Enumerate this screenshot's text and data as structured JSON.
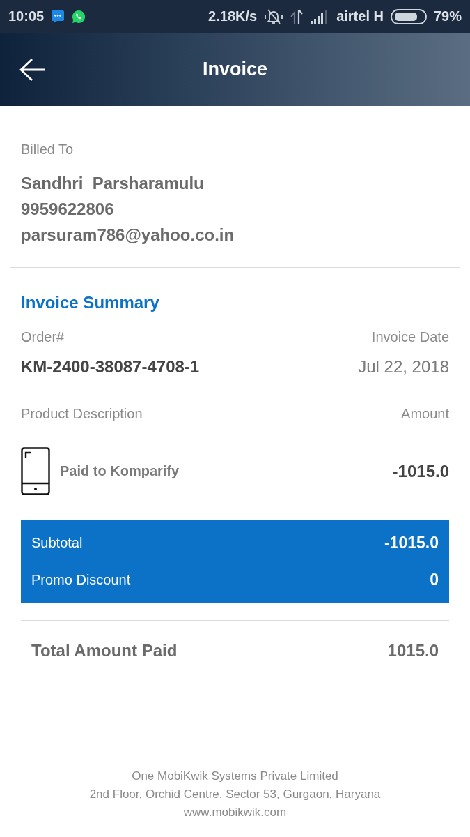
{
  "status_bar": {
    "time": "10:05",
    "network_speed": "2.18K/s",
    "carrier": "airtel H",
    "battery": "79%"
  },
  "app_bar": {
    "title": "Invoice"
  },
  "billed_to": {
    "heading": "Billed To",
    "name": "Sandhri  Parsharamulu",
    "phone": "9959622806",
    "email": "parsuram786@yahoo.co.in"
  },
  "invoice_summary": {
    "heading": "Invoice Summary",
    "order_label": "Order#",
    "order_number": "KM-2400-38087-4708-1",
    "date_label": "Invoice Date",
    "date": "Jul 22, 2018",
    "description_label": "Product Description",
    "amount_label": "Amount",
    "items": [
      {
        "description": "Paid to Komparify",
        "amount": "-1015.0"
      }
    ],
    "totals": [
      {
        "label": "Subtotal",
        "value": "-1015.0"
      },
      {
        "label": "Promo Discount",
        "value": "0"
      }
    ],
    "total": {
      "label": "Total Amount Paid",
      "value": "1015.0"
    }
  },
  "footer": {
    "lines": [
      "One MobiKwik Systems Private Limited",
      "2nd Floor, Orchid Centre, Sector 53, Gurgaon, Haryana",
      "www.mobikwik.com"
    ]
  }
}
